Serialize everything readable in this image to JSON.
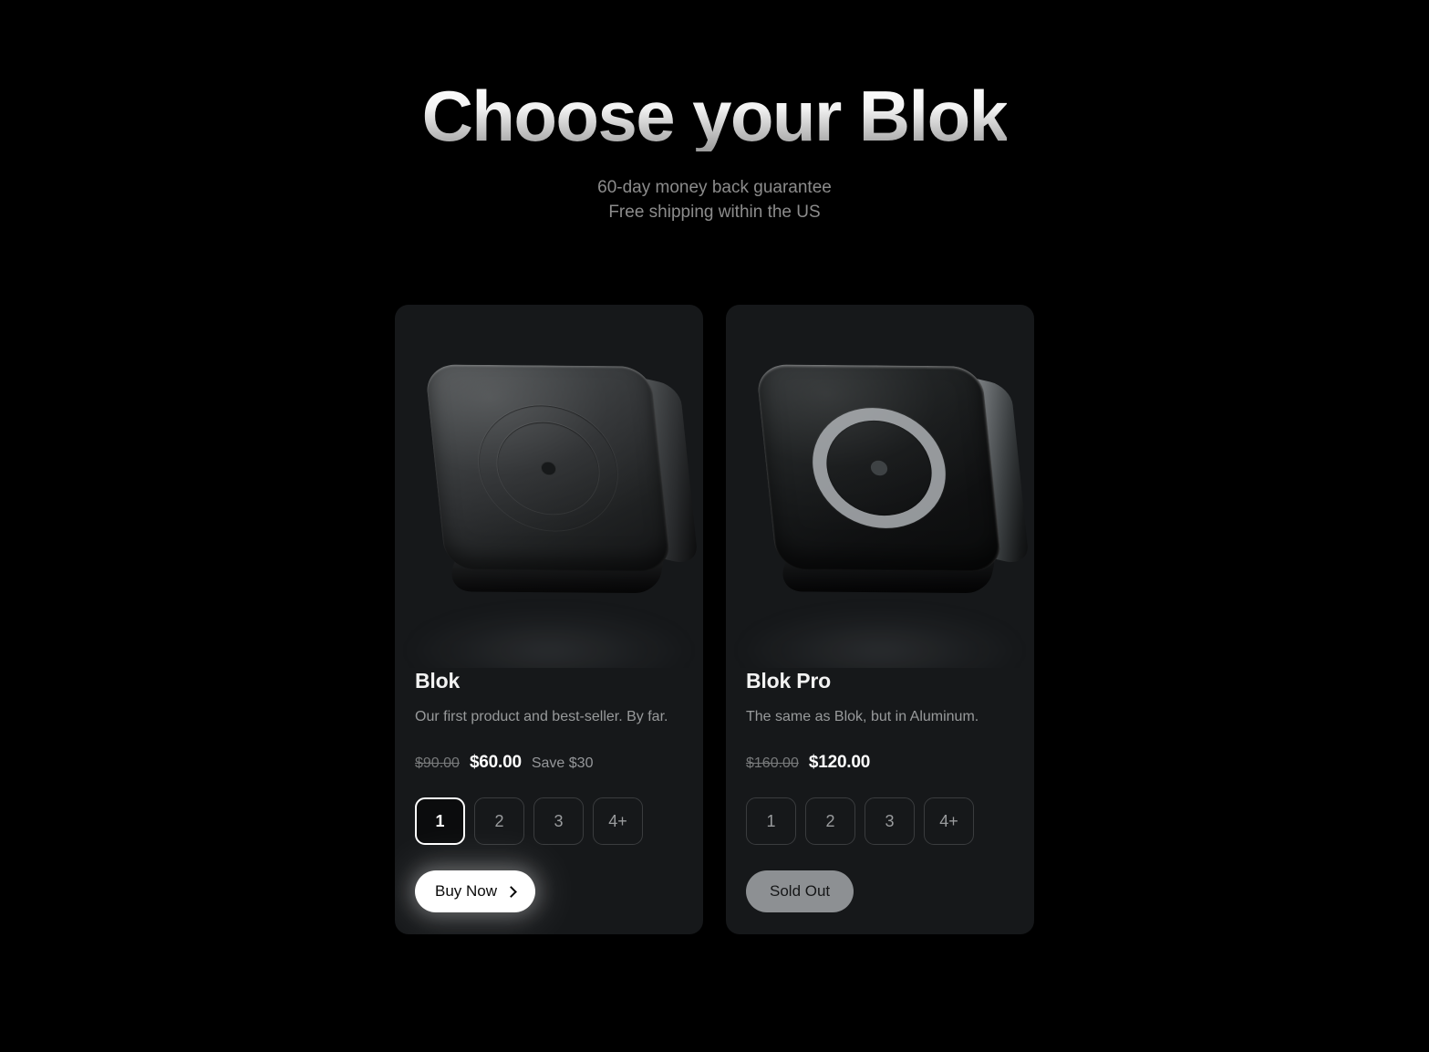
{
  "header": {
    "title": "Choose your Blok",
    "subtitle_line1": "60-day money back guarantee",
    "subtitle_line2": "Free shipping within the US"
  },
  "colors": {
    "page_background": "#000000",
    "card_background": "#16181a",
    "title_gradient_top": "#ffffff",
    "title_gradient_bottom": "#9b9b9b",
    "muted_text": "#8c8c8c",
    "selected_border": "#ffffff",
    "buy_button_background": "#ffffff",
    "sold_out_background": "#8d9093"
  },
  "products": [
    {
      "id": "blok",
      "name": "Blok",
      "description": "Our first product and best-seller. By far.",
      "price_original": "$90.00",
      "price_current": "$60.00",
      "savings": "Save $30",
      "image_alt": "blok-product-image",
      "quantities": [
        {
          "label": "1",
          "selected": true
        },
        {
          "label": "2",
          "selected": false
        },
        {
          "label": "3",
          "selected": false
        },
        {
          "label": "4+",
          "selected": false
        }
      ],
      "cta": {
        "type": "buy",
        "label": "Buy Now",
        "icon": "chevron-right-icon",
        "enabled": true
      }
    },
    {
      "id": "blok-pro",
      "name": "Blok Pro",
      "description": "The same as Blok, but in Aluminum.",
      "price_original": "$160.00",
      "price_current": "$120.00",
      "savings": "",
      "image_alt": "blok-pro-product-image",
      "quantities": [
        {
          "label": "1",
          "selected": false
        },
        {
          "label": "2",
          "selected": false
        },
        {
          "label": "3",
          "selected": false
        },
        {
          "label": "4+",
          "selected": false
        }
      ],
      "cta": {
        "type": "soldout",
        "label": "Sold Out",
        "icon": "",
        "enabled": false
      }
    }
  ]
}
